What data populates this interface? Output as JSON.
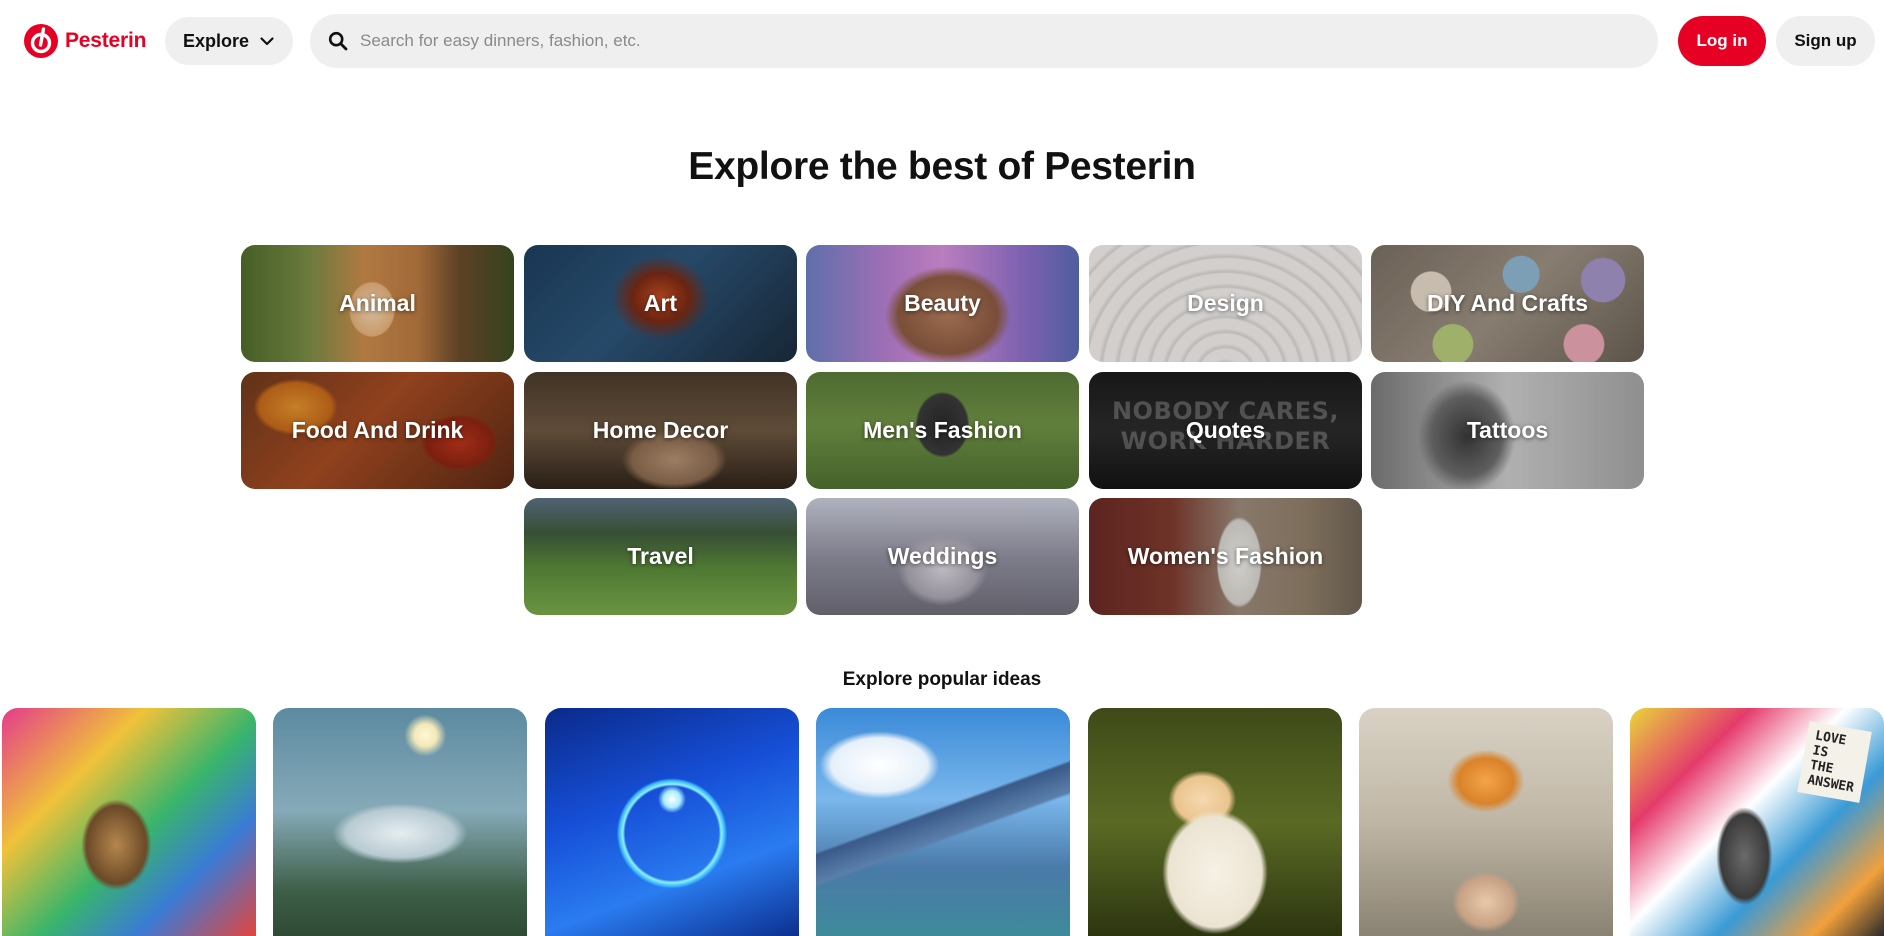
{
  "header": {
    "logo_text": "Pesterin",
    "explore_label": "Explore",
    "search_placeholder": "Search for easy dinners, fashion, etc.",
    "login_label": "Log in",
    "signup_label": "Sign up"
  },
  "hero": {
    "title": "Explore the best of Pesterin"
  },
  "categories": [
    {
      "label": "Animal"
    },
    {
      "label": "Art"
    },
    {
      "label": "Beauty"
    },
    {
      "label": "Design"
    },
    {
      "label": "DIY And Crafts"
    },
    {
      "label": "Food And Drink"
    },
    {
      "label": "Home Decor"
    },
    {
      "label": "Men's Fashion"
    },
    {
      "label": "Quotes"
    },
    {
      "label": "Tattoos"
    },
    {
      "label": "Travel"
    },
    {
      "label": "Weddings"
    },
    {
      "label": "Women's Fashion"
    }
  ],
  "quotes_tile_image_text": "NOBODY CARES,\nWORK HARDER",
  "popular": {
    "heading": "Explore popular ideas",
    "ideas": [
      {
        "image": "street-art-mona-lisa-collage"
      },
      {
        "image": "sunlit-cloudy-sky-forest"
      },
      {
        "image": "blue-magic-portal-art"
      },
      {
        "image": "floating-mountain-castle-landscape"
      },
      {
        "image": "fluffy-cream-cat"
      },
      {
        "image": "tiger-hat-child-figure"
      },
      {
        "image": "einstein-graffiti-love-sign",
        "sign_text": "LOVE\nIS\nTHE\nANSWER"
      }
    ]
  },
  "colors": {
    "brand": "#e60023",
    "button_gray": "#efefef",
    "text": "#111111"
  }
}
